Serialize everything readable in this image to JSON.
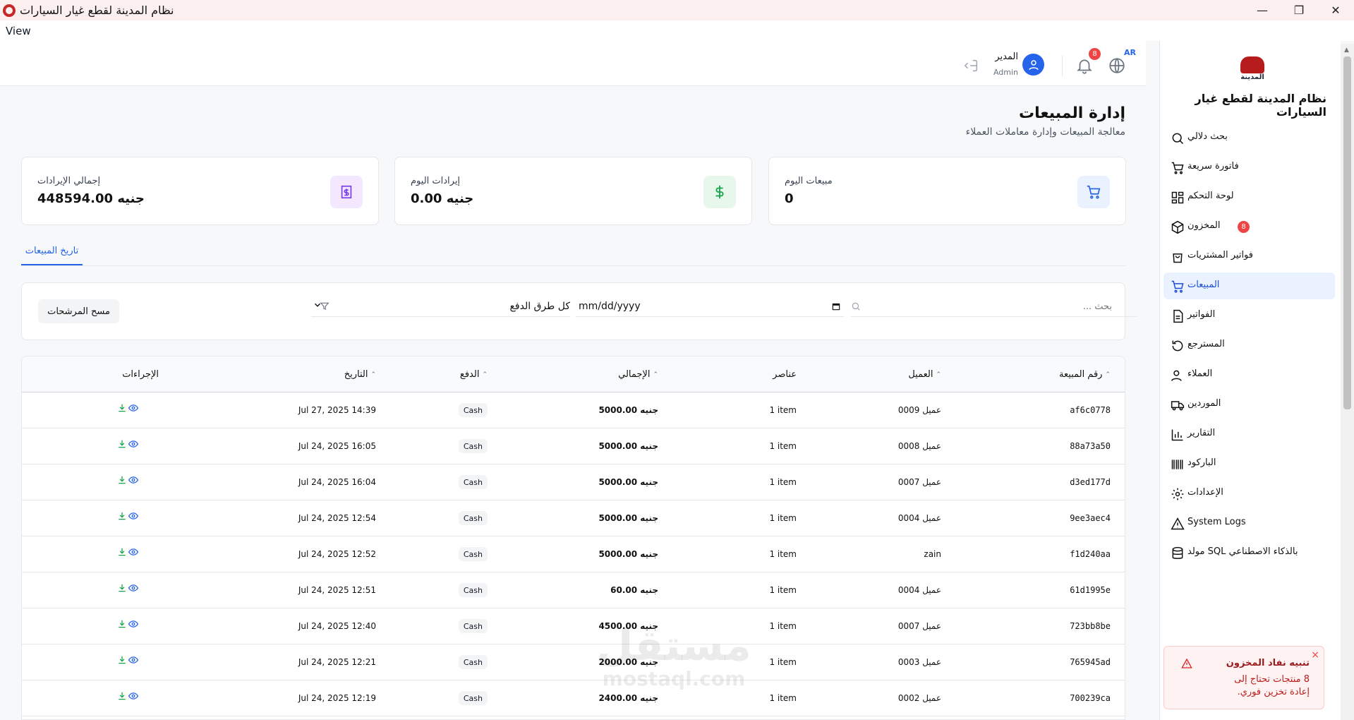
{
  "window": {
    "title": "نظام المدينة لقطع غيار السيارات",
    "menu_view": "View",
    "minimize": "—",
    "maximize": "❐",
    "close": "✕"
  },
  "header": {
    "lang_code": "AR",
    "notification_count": "8",
    "user_name": "المدير",
    "user_role": "Admin"
  },
  "sidebar": {
    "logo_text": "المدينة",
    "brand": "نظام المدينة لقطع غيار السيارات",
    "items": [
      {
        "label": "بحث دلالي",
        "icon": "search-icon"
      },
      {
        "label": "فاتورة سريعة",
        "icon": "cart-icon"
      },
      {
        "label": "لوحة التحكم",
        "icon": "dashboard-icon"
      },
      {
        "label": "المخزون",
        "icon": "box-icon",
        "badge": "8"
      },
      {
        "label": "فواتير المشتريات",
        "icon": "bag-icon"
      },
      {
        "label": "المبيعات",
        "icon": "cart-icon",
        "active": true
      },
      {
        "label": "الفواتير",
        "icon": "document-icon"
      },
      {
        "label": "المسترجع",
        "icon": "refresh-icon"
      },
      {
        "label": "العملاء",
        "icon": "user-icon"
      },
      {
        "label": "الموردين",
        "icon": "truck-icon"
      },
      {
        "label": "التقارير",
        "icon": "chart-icon"
      },
      {
        "label": "الباركود",
        "icon": "barcode-icon"
      },
      {
        "label": "الإعدادات",
        "icon": "gear-icon"
      },
      {
        "label": "System Logs",
        "icon": "warning-icon"
      },
      {
        "label": "مولد SQL بالذكاء الاصطناعي",
        "icon": "database-icon"
      }
    ]
  },
  "page": {
    "title": "إدارة المبيعات",
    "subtitle": "معالجة المبيعات وإدارة معاملات العملاء"
  },
  "stats": {
    "today_sales_label": "مبيعات اليوم",
    "today_sales_value": "0",
    "today_revenue_label": "إيرادات اليوم",
    "today_revenue_value": "جنيه 0.00",
    "total_revenue_label": "إجمالي الإيرادات",
    "total_revenue_value": "جنيه 448594.00"
  },
  "tabs": {
    "history": "تاريخ المبيعات"
  },
  "filters": {
    "search_placeholder": "بحث ...",
    "date_value": "mm/dd/yyyy",
    "payment_selected": "كل طرق الدفع",
    "clear_label": "مسح المرشحات"
  },
  "table": {
    "headers": {
      "sale_no": "رقم المبيعة",
      "customer": "العميل",
      "items": "عناصر",
      "total": "الإجمالي",
      "payment": "الدفع",
      "date": "التاريخ",
      "actions": "الإجراءات"
    },
    "rows": [
      {
        "id": "af6c0778",
        "customer": "عميل 0009",
        "items": "1 item",
        "total": "جنيه 5000.00",
        "payment": "Cash",
        "date": "Jul 27, 2025 14:39"
      },
      {
        "id": "88a73a50",
        "customer": "عميل 0008",
        "items": "1 item",
        "total": "جنيه 5000.00",
        "payment": "Cash",
        "date": "Jul 24, 2025 16:05"
      },
      {
        "id": "d3ed177d",
        "customer": "عميل 0007",
        "items": "1 item",
        "total": "جنيه 5000.00",
        "payment": "Cash",
        "date": "Jul 24, 2025 16:04"
      },
      {
        "id": "9ee3aec4",
        "customer": "عميل 0004",
        "items": "1 item",
        "total": "جنيه 5000.00",
        "payment": "Cash",
        "date": "Jul 24, 2025 12:54"
      },
      {
        "id": "f1d240aa",
        "customer": "zain",
        "items": "1 item",
        "total": "جنيه 5000.00",
        "payment": "Cash",
        "date": "Jul 24, 2025 12:52"
      },
      {
        "id": "61d1995e",
        "customer": "عميل 0004",
        "items": "1 item",
        "total": "جنيه 60.00",
        "payment": "Cash",
        "date": "Jul 24, 2025 12:51"
      },
      {
        "id": "723bb8be",
        "customer": "عميل 0007",
        "items": "1 item",
        "total": "جنيه 4500.00",
        "payment": "Cash",
        "date": "Jul 24, 2025 12:40"
      },
      {
        "id": "765945ad",
        "customer": "عميل 0003",
        "items": "1 item",
        "total": "جنيه 2000.00",
        "payment": "Cash",
        "date": "Jul 24, 2025 12:21"
      },
      {
        "id": "700239ca",
        "customer": "عميل 0002",
        "items": "1 item",
        "total": "جنيه 2400.00",
        "payment": "Cash",
        "date": "Jul 24, 2025 12:19"
      }
    ]
  },
  "toast": {
    "title": "تنبيه نفاد المخزون",
    "body": "8 منتجات تحتاج إلى إعادة تخزين فوري.",
    "close": "×"
  },
  "watermark": {
    "line1": "مستقل",
    "line2": "mostaql.com"
  },
  "colors": {
    "accent": "#2563eb",
    "danger": "#ef4444",
    "success": "#16a34a",
    "purple": "#7c3aed"
  }
}
